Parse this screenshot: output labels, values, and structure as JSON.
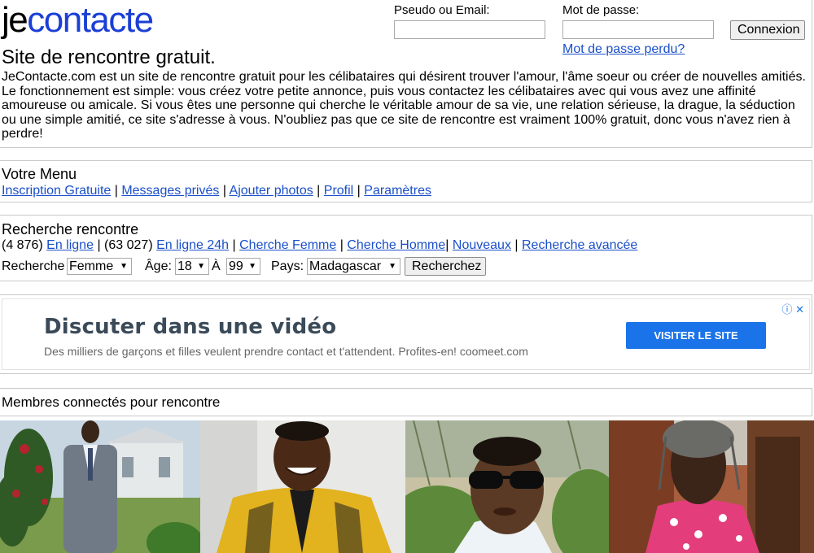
{
  "header": {
    "logo_part1": "je",
    "logo_part2": "contacte",
    "tagline": "Site de rencontre gratuit.",
    "intro": "JeContacte.com est un site de rencontre gratuit pour les célibataires qui désirent trouver l'amour, l'âme soeur ou créer de nouvelles amitiés. Le fonctionnement est simple: vous créez votre petite annonce, puis vous contactez les célibataires avec qui vous avez une affinité amoureuse ou amicale. Si vous êtes une personne qui cherche le véritable amour de sa vie, une relation sérieuse, la drague, la séduction ou une simple amitié, ce site s'adresse à vous. N'oubliez pas que ce site de rencontre est vraiment 100% gratuit, donc vous n'avez rien à perdre!"
  },
  "login": {
    "username_label": "Pseudo ou Email:",
    "username_value": "",
    "password_label": "Mot de passe:",
    "password_value": "",
    "submit_label": "Connexion",
    "lost_password": "Mot de passe perdu?"
  },
  "menu": {
    "title": "Votre Menu",
    "items": [
      "Inscription Gratuite",
      "Messages privés",
      "Ajouter photos",
      "Profil",
      "Paramètres"
    ],
    "separator": " | "
  },
  "search": {
    "title": "Recherche rencontre",
    "online_count": "(4 876)",
    "online_label": "En ligne",
    "online24_count": "(63 027)",
    "online24_label": "En ligne 24h",
    "women_label": "Cherche Femme",
    "men_label": "Cherche Homme",
    "new_label": "Nouveaux",
    "advanced_label": "Recherche avancée",
    "form": {
      "search_label": "Recherche",
      "gender_value": "Femme",
      "age_label": "Âge:",
      "age_min": "18",
      "age_sep": "À",
      "age_max": "99",
      "country_label": "Pays:",
      "country_value": "Madagascar",
      "submit_label": "Recherchez"
    }
  },
  "ad": {
    "title": "Discuter dans une vidéo",
    "subtitle": "Des milliers de garçons et filles veulent prendre contact et t'attendent. Profites-en! coomeet.com",
    "cta": "VISITER LE SITE",
    "info_icon": "ⓘ",
    "close_icon": "✕"
  },
  "members": {
    "title": "Membres connectés pour rencontre"
  }
}
